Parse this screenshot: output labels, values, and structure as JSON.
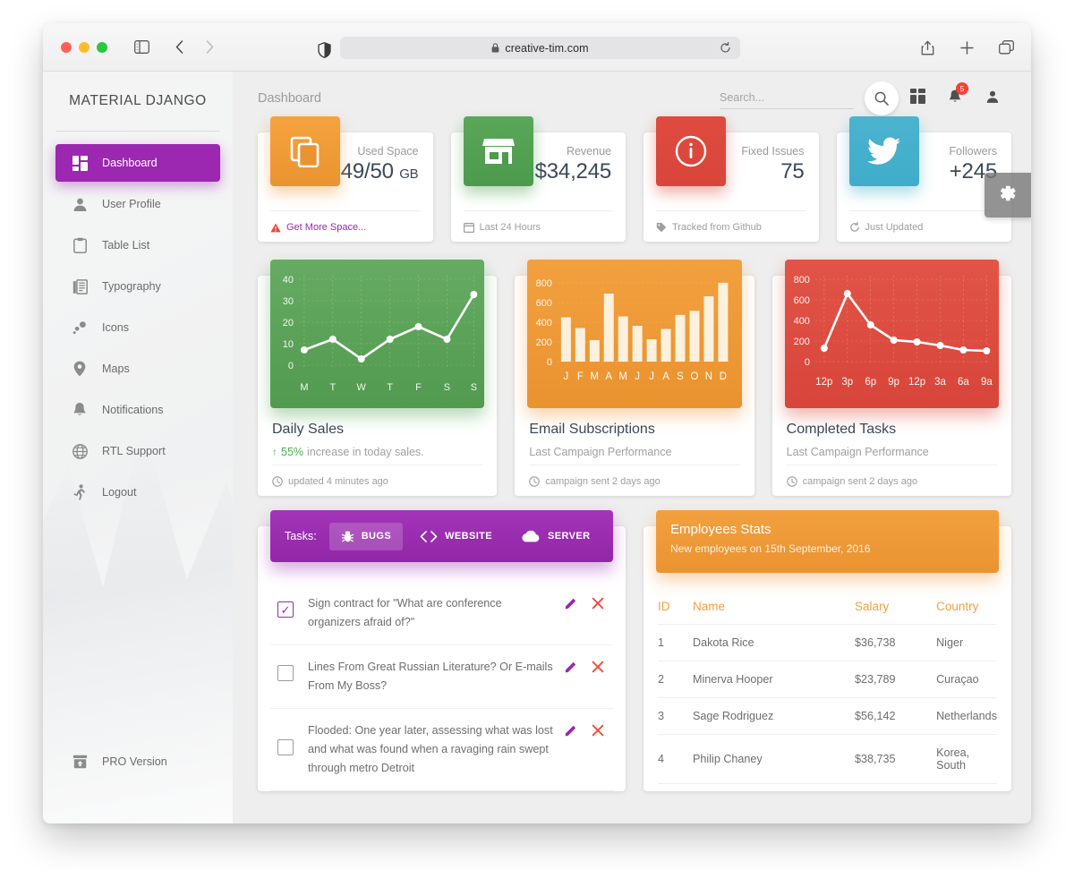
{
  "browser": {
    "url": "creative-tim.com",
    "lock_icon": "lock-icon",
    "reload_icon": "reload-icon",
    "back_icon": "chevron-left-icon",
    "forward_icon": "chevron-right-icon",
    "sidebar_icon": "sidebar-toggle-icon",
    "shield_icon": "shield-icon",
    "share_icon": "share-icon",
    "new_tab_icon": "plus-icon",
    "tabs_icon": "tab-overview-icon"
  },
  "sidebar": {
    "brand": "MATERIAL DJANGO",
    "items": [
      {
        "label": "Dashboard",
        "icon": "dashboard-grid-icon",
        "active": true
      },
      {
        "label": "User Profile",
        "icon": "person-icon",
        "active": false
      },
      {
        "label": "Table List",
        "icon": "clipboard-icon",
        "active": false
      },
      {
        "label": "Typography",
        "icon": "typography-icon",
        "active": false
      },
      {
        "label": "Icons",
        "icon": "bubbles-icon",
        "active": false
      },
      {
        "label": "Maps",
        "icon": "map-pin-icon",
        "active": false
      },
      {
        "label": "Notifications",
        "icon": "bell-icon",
        "active": false
      },
      {
        "label": "RTL Support",
        "icon": "globe-icon",
        "active": false
      },
      {
        "label": "Logout",
        "icon": "running-person-icon",
        "active": false
      }
    ],
    "footer": {
      "label": "PRO Version",
      "icon": "unarchive-icon"
    }
  },
  "topnav": {
    "page_title": "Dashboard",
    "search_placeholder": "Search...",
    "search_value": "",
    "search_icon": "search-icon",
    "apps_icon": "dashboard-grid-icon",
    "bell_icon": "bell-icon",
    "notification_count": "5",
    "account_icon": "person-icon",
    "settings_icon": "gear-icon"
  },
  "stats": [
    {
      "label": "Used Space",
      "value": "49/50",
      "unit": "GB",
      "icon": "content-copy-icon",
      "color": "#ea9331",
      "footer": "Get More Space...",
      "footer_icon": "warning-icon",
      "footer_is_link": true
    },
    {
      "label": "Revenue",
      "value": "$34,245",
      "unit": "",
      "icon": "store-icon",
      "color": "#4c9a4c",
      "footer": "Last 24 Hours",
      "footer_icon": "calendar-icon",
      "footer_is_link": false
    },
    {
      "label": "Fixed Issues",
      "value": "75",
      "unit": "",
      "icon": "info-icon",
      "color": "#d8453a",
      "footer": "Tracked from Github",
      "footer_icon": "tag-icon",
      "footer_is_link": false
    },
    {
      "label": "Followers",
      "value": "+245",
      "unit": "",
      "icon": "twitter-icon",
      "color": "#3fadc9",
      "footer": "Just Updated",
      "footer_icon": "refresh-icon",
      "footer_is_link": false
    }
  ],
  "chart_cards": [
    {
      "title": "Daily Sales",
      "subtitle_pct": "55%",
      "subtitle_rest": "increase in today sales.",
      "footer": "updated 4 minutes ago",
      "footer_icon": "clock-icon"
    },
    {
      "title": "Email Subscriptions",
      "subtitle": "Last Campaign Performance",
      "footer": "campaign sent 2 days ago",
      "footer_icon": "clock-icon"
    },
    {
      "title": "Completed Tasks",
      "subtitle": "Last Campaign Performance",
      "footer": "campaign sent 2 days ago",
      "footer_icon": "clock-icon"
    }
  ],
  "chart_data": [
    {
      "type": "line",
      "title": "Daily Sales",
      "categories": [
        "M",
        "T",
        "W",
        "T",
        "F",
        "S",
        "S"
      ],
      "values": [
        7,
        12,
        3,
        12,
        18,
        12,
        33
      ],
      "yticks": [
        0,
        10,
        20,
        30,
        40
      ],
      "ylim": [
        0,
        45
      ],
      "xlabel": "",
      "ylabel": "",
      "grid": true,
      "line_color": "#ffffff",
      "background": "#589e55"
    },
    {
      "type": "bar",
      "title": "Email Subscriptions",
      "categories": [
        "J",
        "F",
        "M",
        "A",
        "M",
        "J",
        "J",
        "A",
        "S",
        "O",
        "N",
        "D"
      ],
      "values": [
        450,
        350,
        225,
        690,
        460,
        365,
        230,
        345,
        475,
        515,
        665,
        800
      ],
      "yticks": [
        0,
        200,
        400,
        600,
        800
      ],
      "ylim": [
        0,
        860
      ],
      "xlabel": "",
      "ylabel": "",
      "grid": true,
      "bar_color": "#fdf0dc",
      "background": "#ec982f"
    },
    {
      "type": "line",
      "title": "Completed Tasks",
      "categories": [
        "12p",
        "3p",
        "6p",
        "9p",
        "12p",
        "3a",
        "6a",
        "9a"
      ],
      "values": [
        130,
        660,
        355,
        205,
        190,
        160,
        110,
        100
      ],
      "yticks": [
        0,
        200,
        400,
        600,
        800
      ],
      "ylim": [
        0,
        880
      ],
      "xlabel": "",
      "ylabel": "",
      "grid": true,
      "line_color": "#ffffff",
      "background": "#db4a3e"
    }
  ],
  "tasks": {
    "label": "Tasks:",
    "tabs": [
      {
        "label": "BUGS",
        "icon": "bug-icon",
        "active": true
      },
      {
        "label": "WEBSITE",
        "icon": "code-icon",
        "active": false
      },
      {
        "label": "SERVER",
        "icon": "cloud-icon",
        "active": false
      }
    ],
    "edit_icon": "pencil-icon",
    "delete_icon": "close-icon",
    "rows": [
      {
        "checked": true,
        "text": "Sign contract for \"What are conference organizers afraid of?\""
      },
      {
        "checked": false,
        "text": "Lines From Great Russian Literature? Or E-mails From My Boss?"
      },
      {
        "checked": false,
        "text": "Flooded: One year later, assessing what was lost and what was found when a ravaging rain swept through metro Detroit"
      }
    ]
  },
  "employees": {
    "title": "Employees Stats",
    "subtitle": "New employees on 15th September, 2016",
    "columns": [
      "ID",
      "Name",
      "Salary",
      "Country"
    ],
    "rows": [
      [
        "1",
        "Dakota Rice",
        "$36,738",
        "Niger"
      ],
      [
        "2",
        "Minerva Hooper",
        "$23,789",
        "Curaçao"
      ],
      [
        "3",
        "Sage Rodriguez",
        "$56,142",
        "Netherlands"
      ],
      [
        "4",
        "Philip Chaney",
        "$38,735",
        "Korea, South"
      ]
    ]
  },
  "colors": {
    "primary": "#9c27b0",
    "orange": "#ea9331",
    "green": "#4c9a4c",
    "red": "#d8453a",
    "blue": "#3fadc9",
    "text": "#3c4858"
  }
}
